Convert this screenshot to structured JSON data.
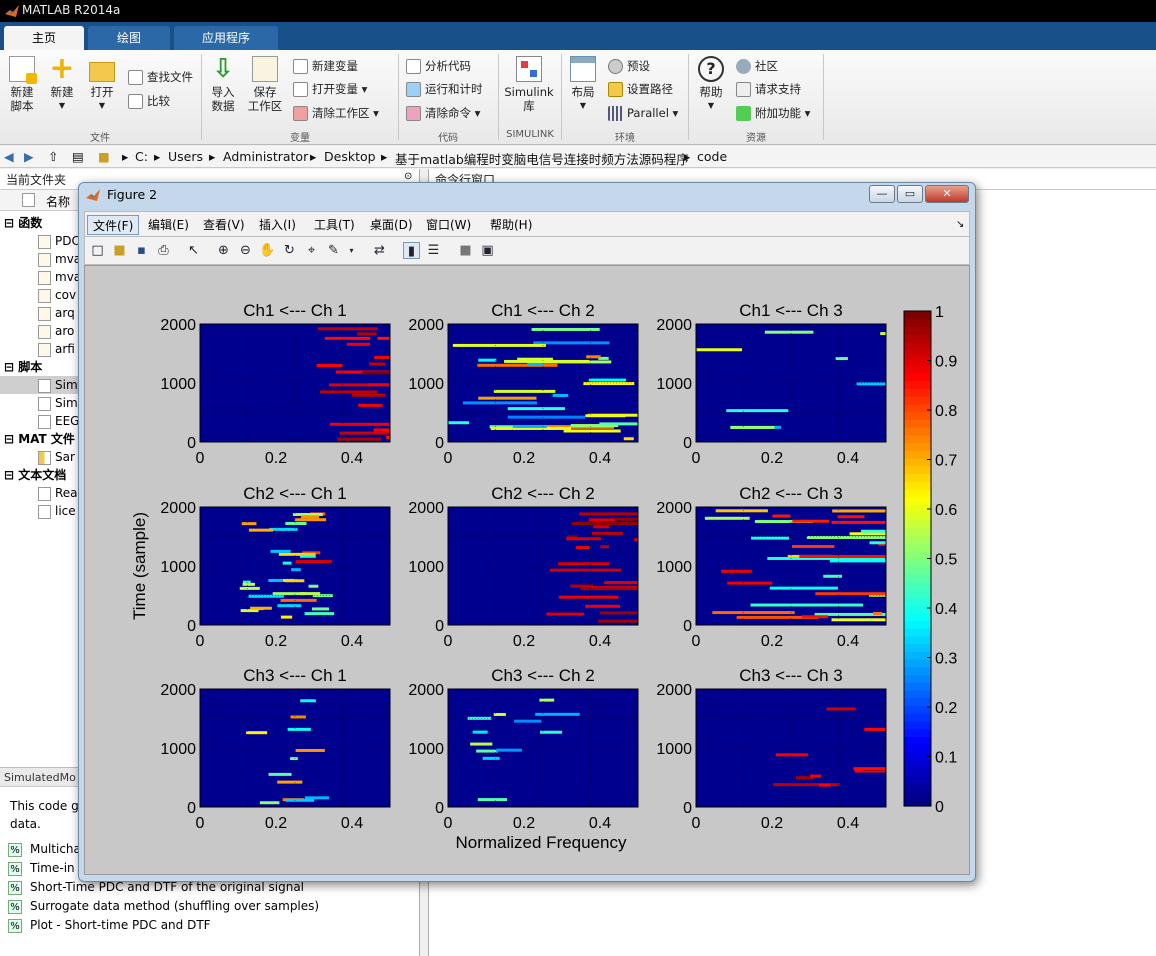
{
  "app": {
    "title": "MATLAB R2014a"
  },
  "tabs": [
    "主页",
    "绘图",
    "应用程序"
  ],
  "ribbon": {
    "new_script": "新建\n脚本",
    "new": "新建",
    "open": "打开",
    "find_files": "查找文件",
    "compare": "比较",
    "import": "导入\n数据",
    "save_ws": "保存\n工作区",
    "new_var": "新建变量",
    "open_var": "打开变量",
    "clear_ws": "清除工作区",
    "analyze": "分析代码",
    "run_time": "运行和计时",
    "clear_cmd": "清除命令",
    "simulink": "Simulink\n库",
    "layout": "布局",
    "prefs": "预设",
    "set_path": "设置路径",
    "parallel": "Parallel",
    "help": "帮助",
    "community": "社区",
    "support": "请求支持",
    "addons": "附加功能",
    "sections": {
      "file": "文件",
      "variable": "变量",
      "code": "代码",
      "simulink": "SIMULINK",
      "env": "环境",
      "resources": "资源"
    }
  },
  "address": {
    "parts": [
      "C:",
      "Users",
      "Administrator",
      "Desktop",
      "基于matlab编程时变脑电信号连接时频方法源码程序",
      "code"
    ]
  },
  "left_panel": {
    "title": "当前文件夹",
    "col_name": "名称",
    "groups": [
      {
        "label": "函数",
        "items": [
          "PDC",
          "mva",
          "mva",
          "cov",
          "arq",
          "aro",
          "arfi"
        ]
      },
      {
        "label": "脚本",
        "items": [
          "Sim",
          "Sim",
          "EEG"
        ]
      },
      {
        "label": "MAT 文件",
        "items": [
          "Sar"
        ]
      },
      {
        "label": "文本文档",
        "items": [
          "Rea",
          "lice"
        ]
      }
    ],
    "detail_title": "SimulatedMo",
    "detail_text": "This code g\ndata.",
    "detail_items": [
      "Multicha",
      "Time-in",
      "Short-Time  PDC and DTF of the original signal",
      "Surrogate data method (shuffling over samples)",
      "Plot - Short-time PDC and DTF"
    ]
  },
  "command": {
    "title": "命令行窗口"
  },
  "figure": {
    "title": "Figure 2",
    "menus": [
      "文件(F)",
      "编辑(E)",
      "查看(V)",
      "插入(I)",
      "工具(T)",
      "桌面(D)",
      "窗口(W)",
      "帮助(H)"
    ],
    "ylabel": "Time (sample)",
    "xlabel": "Normalized Frequency",
    "subplots": [
      "Ch1 <--- Ch 1",
      "Ch1 <--- Ch 2",
      "Ch1 <--- Ch 3",
      "Ch2 <--- Ch 1",
      "Ch2 <--- Ch 2",
      "Ch2 <--- Ch 3",
      "Ch3 <--- Ch 1",
      "Ch3 <--- Ch 2",
      "Ch3 <--- Ch 3"
    ],
    "yticks": [
      "0",
      "1000",
      "2000"
    ],
    "xticks": [
      "0",
      "0.2",
      "0.4"
    ],
    "colorbar_ticks": [
      "0",
      "0.1",
      "0.2",
      "0.3",
      "0.4",
      "0.5",
      "0.6",
      "0.7",
      "0.8",
      "0.9",
      "1"
    ]
  },
  "colors": {
    "background": "#00008f",
    "tab_bar": "#18508a"
  }
}
